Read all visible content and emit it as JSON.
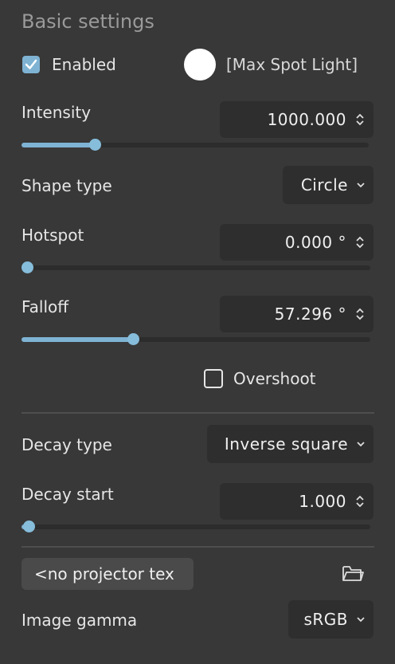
{
  "section": {
    "title": "Basic settings"
  },
  "enabled": {
    "label": "Enabled",
    "checked": true
  },
  "light": {
    "name": "[Max Spot Light]",
    "color": "#ffffff"
  },
  "intensity": {
    "label": "Intensity",
    "value": "1000.000",
    "slider_fraction": 0.21
  },
  "shape_type": {
    "label": "Shape type",
    "value": "Circle"
  },
  "hotspot": {
    "label": "Hotspot",
    "value": "0.000 °",
    "slider_fraction": 0.0
  },
  "falloff": {
    "label": "Falloff",
    "value": "57.296 °",
    "slider_fraction": 0.32
  },
  "overshoot": {
    "label": "Overshoot",
    "checked": false
  },
  "decay_type": {
    "label": "Decay type",
    "value": "Inverse square"
  },
  "decay_start": {
    "label": "Decay start",
    "value": "1.000",
    "slider_fraction": 0.02
  },
  "projector": {
    "label": "<no projector tex"
  },
  "image_gamma": {
    "label": "Image gamma",
    "value": "sRGB"
  },
  "colors": {
    "accent": "#7fb3d4",
    "background": "#383838",
    "field": "#2e2e2e"
  }
}
